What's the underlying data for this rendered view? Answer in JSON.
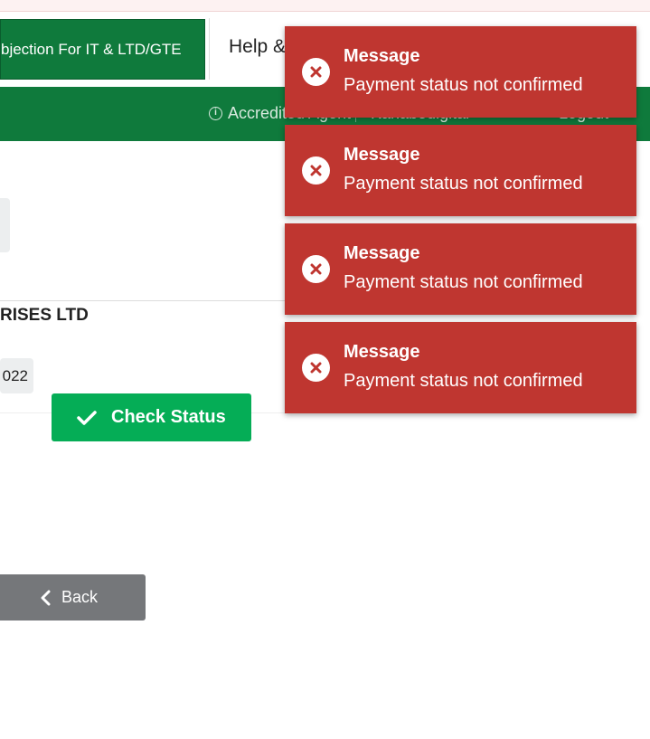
{
  "nav": {
    "active_tab": "bjection For IT & LTD/GTE",
    "help": "Help &"
  },
  "topbar": {
    "role": "Accredited Agent",
    "user": "Kanabedigital",
    "logout": "Logout"
  },
  "main": {
    "company": "RISES LTD",
    "year": "022",
    "check_status_label": "Check Status",
    "back_label": "Back"
  },
  "toasts": [
    {
      "title": "Message",
      "message": "Payment status not confirmed"
    },
    {
      "title": "Message",
      "message": "Payment status not confirmed"
    },
    {
      "title": "Message",
      "message": "Payment status not confirmed"
    },
    {
      "title": "Message",
      "message": "Payment status not confirmed"
    }
  ],
  "colors": {
    "brand_green": "#0f7a3c",
    "success_green": "#05ad56",
    "error_red": "#bf3630",
    "back_grey": "#75777a"
  }
}
